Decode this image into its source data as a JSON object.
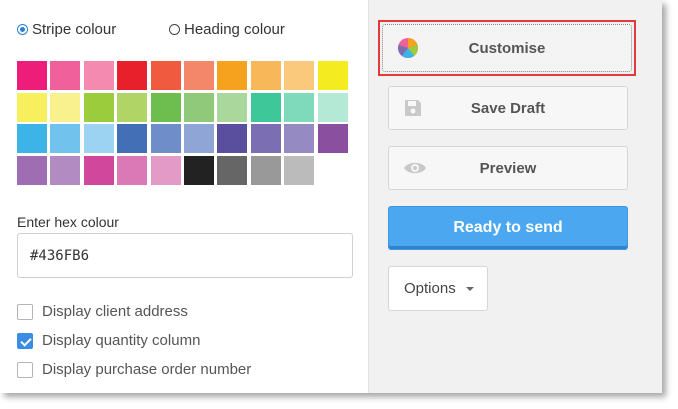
{
  "colour_panel": {
    "stripe_radio": "Stripe colour",
    "heading_radio": "Heading colour",
    "swatches": [
      "#ee1d7a",
      "#f0609a",
      "#f48ab0",
      "#e8202b",
      "#f05a3e",
      "#f4866a",
      "#f6a21e",
      "#f8b85a",
      "#fbc97c",
      "#f4ec21",
      "#f7ef5e",
      "#f9f18e",
      "#9bcc3c",
      "#b0d465",
      "#6ebe4f",
      "#90c97a",
      "#a9d79c",
      "#3ec89a",
      "#7edabb",
      "#b4e9d6",
      "#3cb4e8",
      "#72c2ee",
      "#9cd3f3",
      "#436fb6",
      "#6f8ec9",
      "#8fa5d5",
      "#5a4e9f",
      "#7b6eb2",
      "#958bc2",
      "#8a4f9f",
      "#9f6eb2",
      "#b18bc2",
      "#d0479b",
      "#da79b5",
      "#e39ac7",
      "#222222",
      "#666666",
      "#999999",
      "#bbbbbb"
    ],
    "hex_label": "Enter hex colour",
    "hex_value": "#436FB6"
  },
  "options_list": {
    "client_address": "Display client address",
    "quantity_column": "Display quantity column",
    "purchase_order": "Display purchase order number"
  },
  "actions": {
    "customise": "Customise",
    "save_draft": "Save Draft",
    "preview": "Preview",
    "ready": "Ready to send",
    "options": "Options"
  }
}
